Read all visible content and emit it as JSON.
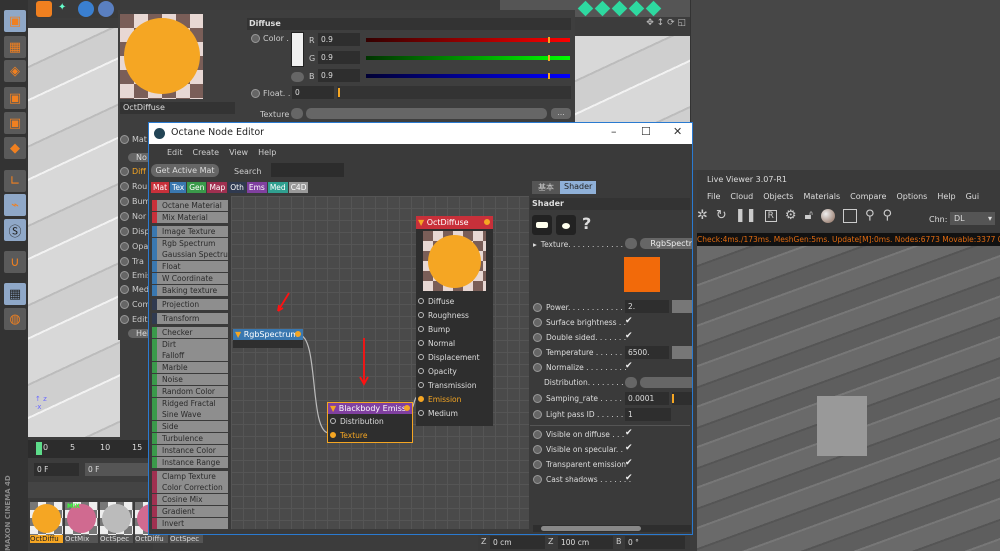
{
  "top_strip": {
    "icons": [
      "move-tool-icon",
      "spline-icon",
      "cube-icon",
      "deformer-icon"
    ]
  },
  "left_toolbar": {
    "icons": [
      "model-mode-icon",
      "texture-mode-icon",
      "workplane-icon",
      "points-mode-icon",
      "edges-mode-icon",
      "polygons-mode-icon",
      "axis-icon",
      "tweak-mouse-icon",
      "snap-icon",
      "magnet-icon",
      "lock-workplane-icon",
      "quantize-icon"
    ]
  },
  "timeline": {
    "ticks": [
      "0",
      "5",
      "10",
      "15"
    ],
    "frame_field": "0 F",
    "frame_field2": "0 F"
  },
  "brand": "MAXON CINEMA 4D",
  "materials": [
    {
      "name": "OctDiffu",
      "selected": true
    },
    {
      "name": "OctMix",
      "badge": "MIX"
    },
    {
      "name": "OctSpec"
    },
    {
      "name": "OctDiffu"
    },
    {
      "name": "OctSpec"
    }
  ],
  "attr": {
    "mat_name": "OctDiffuse",
    "section": "Diffuse",
    "color_label": "Color .",
    "r_label": "R",
    "r": "0.9",
    "g_label": "G",
    "g": "0.9",
    "b_label": "B",
    "b": "0.9",
    "float_label": "Float. .",
    "float": "0",
    "texture_label": "Texture",
    "more": "...",
    "channels": [
      "Mat",
      "No",
      "Diff",
      "Rou",
      "Bum",
      "Nor",
      "Disp",
      "Opa",
      "Tra",
      "Emis",
      "Med",
      "Com",
      "Edit",
      "Hel"
    ]
  },
  "node_editor": {
    "title": "Octane Node Editor",
    "menu": [
      "Edit",
      "Create",
      "View",
      "Help"
    ],
    "get_active": "Get Active Mat",
    "search_label": "Search",
    "search_value": "",
    "categories": [
      {
        "label": "Mat",
        "color": "#c8303a"
      },
      {
        "label": "Tex",
        "color": "#3a78b0"
      },
      {
        "label": "Gen",
        "color": "#3a9a4a"
      },
      {
        "label": "Map",
        "color": "#a03050"
      },
      {
        "label": "Oth",
        "color": "#303a50"
      },
      {
        "label": "Ems",
        "color": "#8040a0"
      },
      {
        "label": "Med",
        "color": "#30a090"
      },
      {
        "label": "C4D",
        "color": "#9a9a9a"
      }
    ],
    "groups": [
      {
        "color": "#c8303a",
        "items": [
          "Octane Material",
          "Mix Material"
        ]
      },
      {
        "color": "#3a78b0",
        "items": [
          "Image Texture",
          "Rgb Spectrum",
          "Gaussian Spectrum",
          "Float",
          "W Coordinate",
          "Baking texture"
        ]
      },
      {
        "color": "#303a50",
        "items": [
          "Projection"
        ]
      },
      {
        "color": "#303a50",
        "items": [
          "Transform"
        ]
      },
      {
        "color": "#3a9a4a",
        "items": [
          "Checker",
          "Dirt",
          "Falloff",
          "Marble",
          "Noise",
          "Random Color",
          "Ridged Fractal",
          "Sine Wave",
          "Side",
          "Turbulence",
          "Instance Color",
          "Instance Range"
        ]
      },
      {
        "color": "#a03050",
        "items": [
          "Clamp Texture",
          "Color Correction",
          "Cosine Mix",
          "Gradient",
          "Invert"
        ]
      }
    ],
    "nodes": {
      "diffuse": {
        "title": "OctDiffuse",
        "ports": [
          "Diffuse",
          "Roughness",
          "Bump",
          "Normal",
          "Displacement",
          "Opacity",
          "Transmission",
          "Emission",
          "Medium"
        ],
        "active_port": "Emission"
      },
      "rgb": {
        "title": "RgbSpectrum"
      },
      "blackbody": {
        "title": "Blackbody Emiss",
        "ports": [
          "Distribution",
          "Texture"
        ],
        "active_port": "Texture"
      }
    },
    "panel": {
      "tabs": [
        "基本",
        "Shader"
      ],
      "active_tab": "Shader",
      "section": "Shader",
      "help": "?",
      "texture_label": "Texture. . . . . . . . . . . .",
      "texture_value": "RgbSpectr",
      "swatch_color": "#f26a0a",
      "power_label": "Power. . . . . . . . . . . . .",
      "power": "2.",
      "surface_label": "Surface brightness . .",
      "double_label": "Double sided. . . . . . .",
      "temp_label": "Temperature . . . . . . .",
      "temp": "6500.",
      "normalize_label": "Normalize . . . . . . . . .",
      "dist_label": "Distribution. . . . . . . .",
      "sampling_label": "Samping_rate . . . . . .",
      "sampling": "0.0001",
      "lightpass_label": "Light pass ID . . . . . . .",
      "lightpass": "1",
      "vis_diffuse_label": "Visible on diffuse . . .",
      "vis_spec_label": "Visible on specular. .",
      "transparent_label": "Transparent emission",
      "cast_label": "Cast shadows . . . . . . .",
      "check": "✔"
    }
  },
  "live_viewer": {
    "title": "Live Viewer 3.07-R1",
    "menu": [
      "File",
      "Cloud",
      "Objects",
      "Materials",
      "Compare",
      "Options",
      "Help",
      "Gui"
    ],
    "chn_label": "Chn:",
    "chn_value": "DL",
    "status": "Check:4ms./173ms. MeshGen:5ms. Update[M]:0ms. Nodes:6773 Movable:3377  0 0"
  },
  "coords": {
    "z1_label": "Z",
    "z1": "0 cm",
    "z2_label": "Z",
    "z2": "100 cm",
    "b_label": "B",
    "b": "0 °"
  }
}
